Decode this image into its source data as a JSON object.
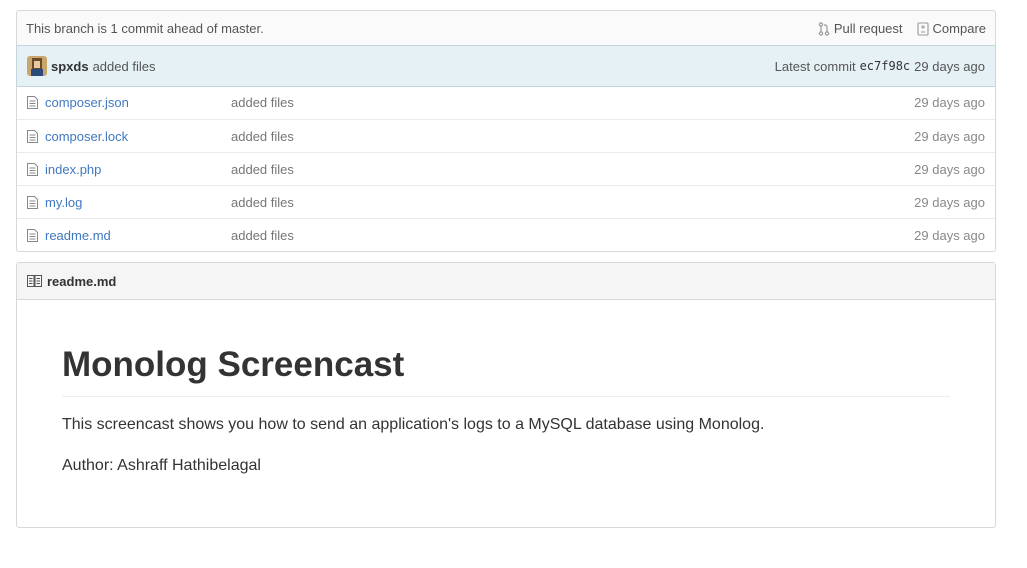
{
  "branch_bar": {
    "message": "This branch is 1 commit ahead of master.",
    "pull_request_label": "Pull request",
    "compare_label": "Compare"
  },
  "commit": {
    "author": "spxds",
    "message": "added files",
    "latest_label": "Latest commit",
    "sha": "ec7f98c",
    "age": "29 days ago"
  },
  "files": [
    {
      "name": "composer.json",
      "message": "added files",
      "age": "29 days ago"
    },
    {
      "name": "composer.lock",
      "message": "added files",
      "age": "29 days ago"
    },
    {
      "name": "index.php",
      "message": "added files",
      "age": "29 days ago"
    },
    {
      "name": "my.log",
      "message": "added files",
      "age": "29 days ago"
    },
    {
      "name": "readme.md",
      "message": "added files",
      "age": "29 days ago"
    }
  ],
  "readme": {
    "filename": "readme.md",
    "title": "Monolog Screencast",
    "paragraphs": [
      "This screencast shows you how to send an application's logs to a MySQL database using Monolog.",
      "Author: Ashraff Hathibelagal"
    ]
  },
  "colors": {
    "link": "#4078c0",
    "commit_bar_bg": "#e6f1f6"
  },
  "icons": {
    "file": "file-text-icon",
    "pull_request": "git-pull-request-icon",
    "compare": "diff-icon",
    "readme": "book-icon"
  }
}
